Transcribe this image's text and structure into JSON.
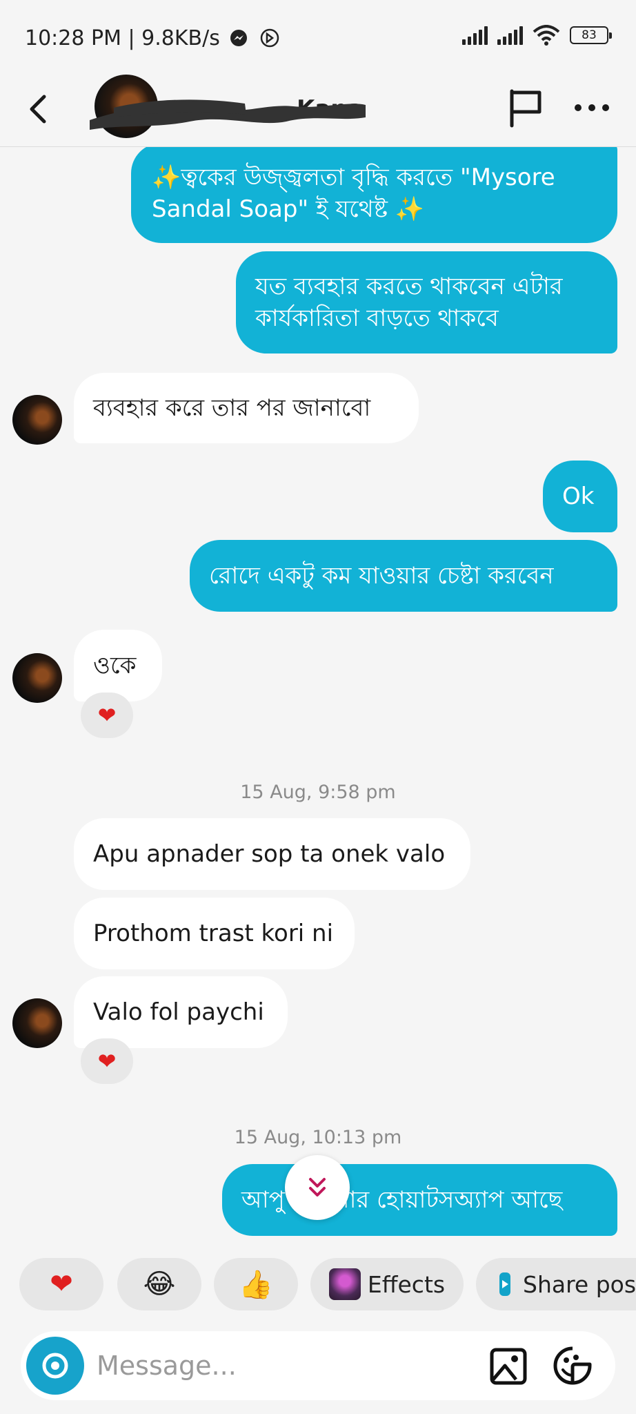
{
  "status_bar": {
    "time_speed": "10:28 PM | 9.8KB/s",
    "battery": "83"
  },
  "header": {
    "name_visible": "Kana"
  },
  "messages": [
    {
      "dir": "out",
      "lines": [
        "✨ত্বকের উজ্জ্বলতা বৃদ্ধি করতে \"Mysore",
        "Sandal Soap\" ই যথেষ্ট ✨"
      ]
    },
    {
      "dir": "out",
      "lines": [
        "যত ব্যবহার করতে থাকবেন এটার",
        "কার্যকারিতা বাড়তে থাকবে"
      ]
    },
    {
      "dir": "in",
      "lines": [
        "ব্যবহার করে তার পর জানাবো"
      ]
    },
    {
      "dir": "out",
      "lines": [
        "Ok"
      ]
    },
    {
      "dir": "out",
      "lines": [
        "রোদে একটু কম যাওয়ার চেষ্টা করবেন"
      ]
    },
    {
      "dir": "in",
      "lines": [
        "ওকে"
      ],
      "reaction": "❤"
    },
    {
      "timestamp": "15 Aug, 9:58 pm"
    },
    {
      "dir": "in",
      "lines": [
        "Apu apnader sop ta onek valo"
      ]
    },
    {
      "dir": "in",
      "lines": [
        "Prothom trast kori ni"
      ]
    },
    {
      "dir": "in",
      "lines": [
        "Valo fol paychi"
      ],
      "reaction": "❤"
    },
    {
      "timestamp": "15 Aug, 10:13 pm"
    },
    {
      "dir": "out",
      "lines": [
        "আপু আপনার হোয়াটসঅ্যাপ আছে"
      ]
    }
  ],
  "quick_replies": {
    "heart": "❤",
    "laugh": "😂",
    "thumbs": "👍",
    "effects_label": "Effects",
    "share_label": "Share post"
  },
  "composer": {
    "placeholder": "Message..."
  },
  "colors": {
    "outgoing_bubble": "#12b2d6",
    "incoming_bubble": "#ffffff",
    "background": "#f5f5f5",
    "reaction_heart": "#e02020"
  }
}
